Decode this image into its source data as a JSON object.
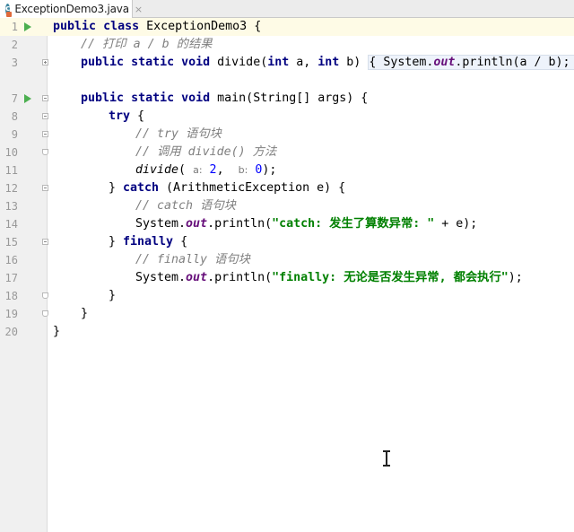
{
  "tab": {
    "icon_letter": "c",
    "filename": "ExceptionDemo3.java",
    "close": "×"
  },
  "line_numbers": [
    "1",
    "2",
    "3",
    "",
    "7",
    "8",
    "9",
    "10",
    "11",
    "12",
    "13",
    "14",
    "15",
    "16",
    "17",
    "18",
    "19",
    "20"
  ],
  "code": {
    "l1": {
      "kw1": "public",
      "kw2": "class",
      "name": "ExceptionDemo3",
      "rest": " {"
    },
    "l2": {
      "comment": "// 打印 a / b 的结果"
    },
    "l3": {
      "kw1": "public",
      "kw2": "static",
      "kw3": "void",
      "sig1": " divide(",
      "kwint1": "int",
      "sig2": " a, ",
      "kwint2": "int",
      "sig3": " b) ",
      "fold_open": "{",
      "body1": " System.",
      "out": "out",
      "body2": ".println(a / b); ",
      "fold_close": "}"
    },
    "l7": {
      "kw1": "public",
      "kw2": "static",
      "kw3": "void",
      "sig": " main(String[] args) {"
    },
    "l8": {
      "kw": "try",
      "rest": " {"
    },
    "l9": {
      "comment": "// try 语句块"
    },
    "l10": {
      "comment": "// 调用 divide() 方法"
    },
    "l11": {
      "call": "divide",
      "p1": "(",
      "hint_a": "a:",
      "v1": "2",
      "sep": ",  ",
      "hint_b": "b:",
      "v2": "0",
      "end": ");"
    },
    "l12": {
      "pre": "} ",
      "kw": "catch",
      "rest": " (ArithmeticException e) {"
    },
    "l13": {
      "comment": "// catch 语句块"
    },
    "l14": {
      "pre": "System.",
      "out": "out",
      "mid": ".println(",
      "str": "\"catch: 发生了算数异常: \"",
      "end": " + e);"
    },
    "l15": {
      "pre": "} ",
      "kw": "finally",
      "rest": " {"
    },
    "l16": {
      "comment": "// finally 语句块"
    },
    "l17": {
      "pre": "System.",
      "out": "out",
      "mid": ".println(",
      "str": "\"finally: 无论是否发生异常, 都会执行\"",
      "end": ");"
    },
    "l18": {
      "text": "}"
    },
    "l19": {
      "text": "}"
    },
    "l20": {
      "text": "}"
    }
  },
  "colors": {
    "keyword": "#000080",
    "comment": "#808080",
    "string": "#008000",
    "number": "#0000ff",
    "static_field": "#660e7a",
    "run_icon": "#4caf50",
    "current_line": "#fefbe6"
  }
}
